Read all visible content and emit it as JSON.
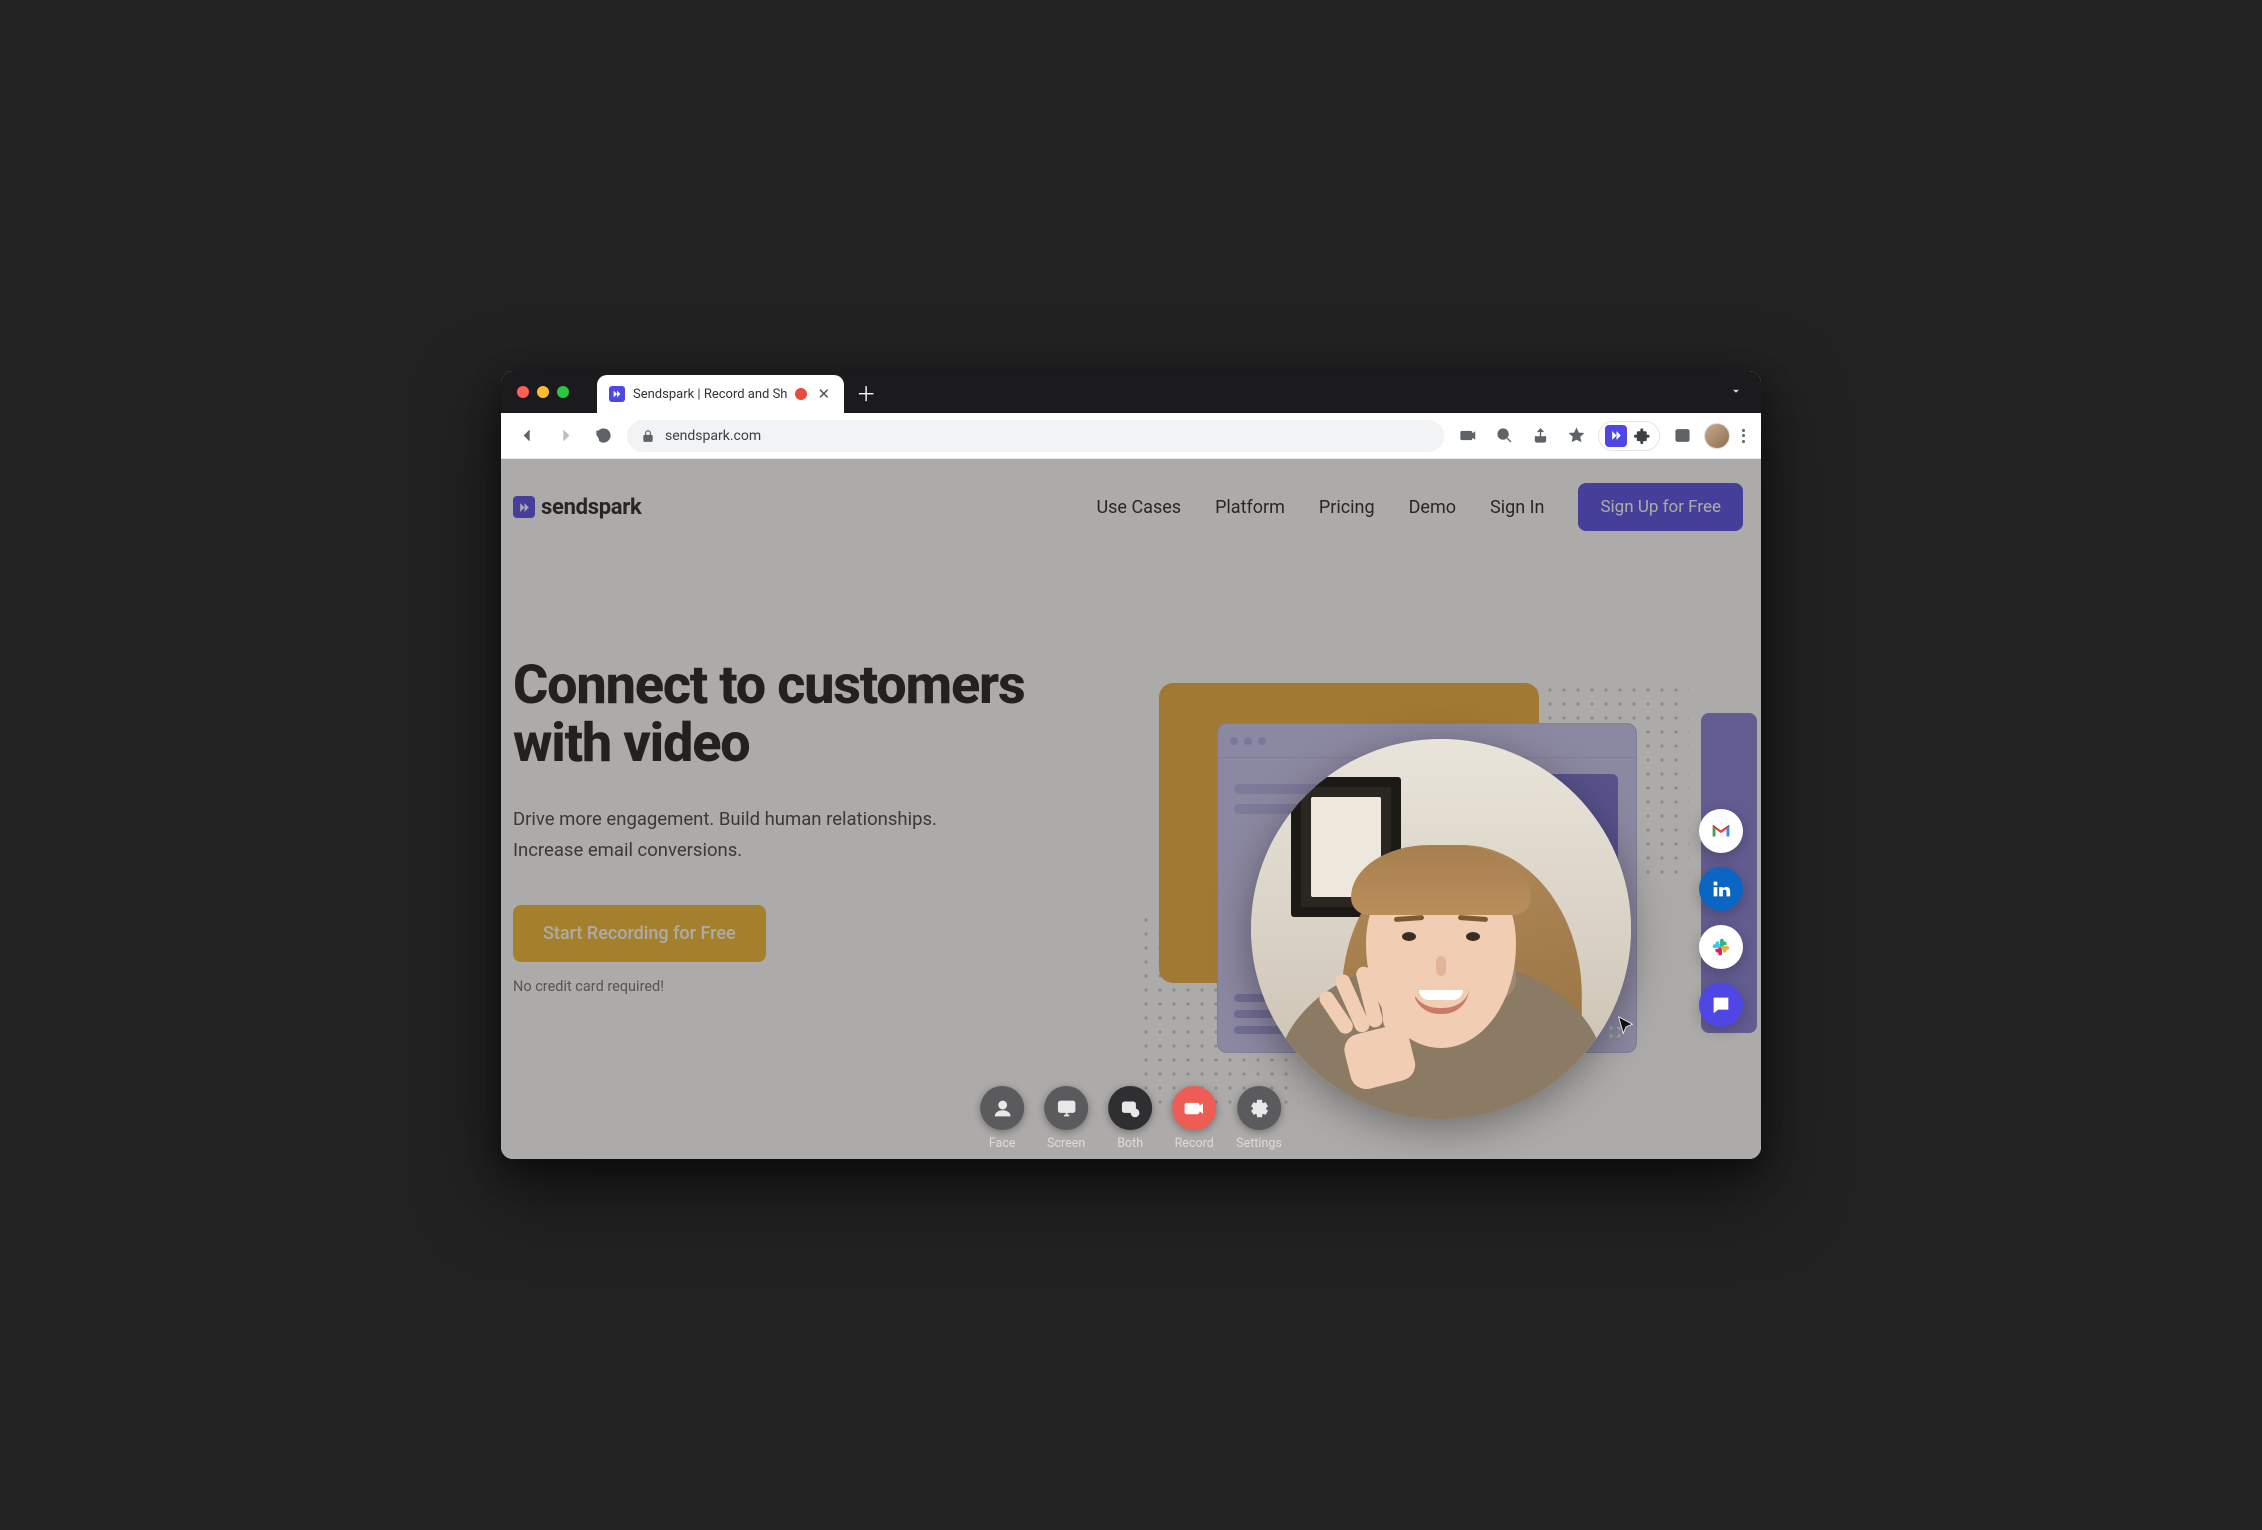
{
  "browser": {
    "tab_title": "Sendspark | Record and Sh",
    "url": "sendspark.com"
  },
  "site": {
    "brand": "sendspark",
    "nav": {
      "use_cases": "Use Cases",
      "platform": "Platform",
      "pricing": "Pricing",
      "demo": "Demo",
      "sign_in": "Sign In"
    },
    "cta": "Sign Up for Free"
  },
  "hero": {
    "headline": "Connect to customers with video",
    "subhead": "Drive more engagement. Build human relationships. Increase email conversions.",
    "primary_button": "Start Recording for Free",
    "note": "No credit card required!"
  },
  "recorder": {
    "face": "Face",
    "screen": "Screen",
    "both": "Both",
    "record": "Record",
    "settings": "Settings"
  }
}
